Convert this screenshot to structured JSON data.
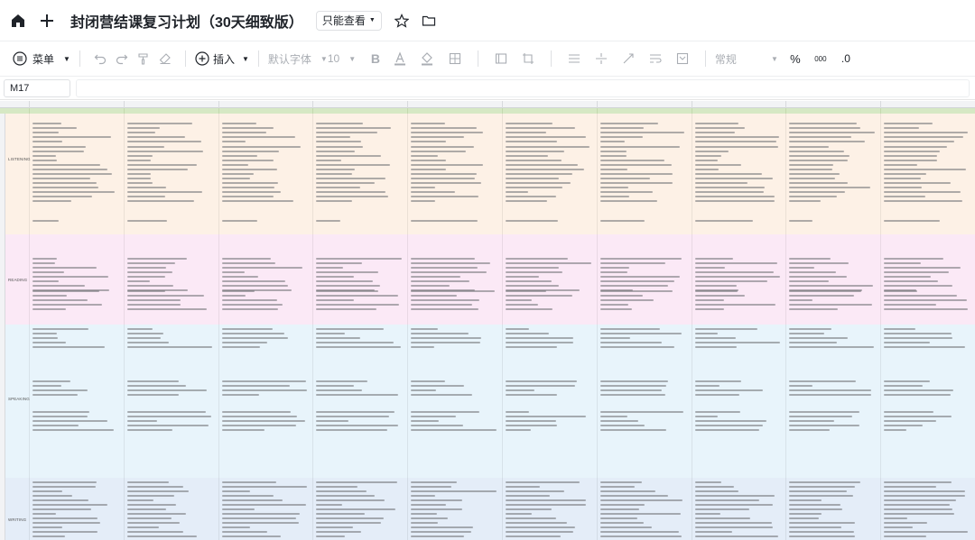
{
  "title_bar": {
    "doc_title": "封闭营结课复习计划（30天细致版）",
    "permission_label": "只能查看",
    "icons": [
      "home-icon",
      "plus-icon",
      "star-icon",
      "folder-icon"
    ]
  },
  "toolbar": {
    "menu_label": "菜单",
    "insert_label": "插入",
    "font_family": "默认字体",
    "font_size": "10",
    "number_format": "常规",
    "percent": "%",
    "thousands": "000",
    "decimal": ".0"
  },
  "formula_bar": {
    "cell_reference": "M17"
  },
  "sheet": {
    "band_labels": [
      "LISTENING",
      "READING",
      "SPEAKING",
      "WRITING"
    ],
    "band_colors": {
      "listening": "#fdf1e6",
      "reading": "#fbe9f6",
      "speaking": "#e8f4fb",
      "writing": "#e4edf8",
      "date_row": "#d6e8c4"
    }
  }
}
